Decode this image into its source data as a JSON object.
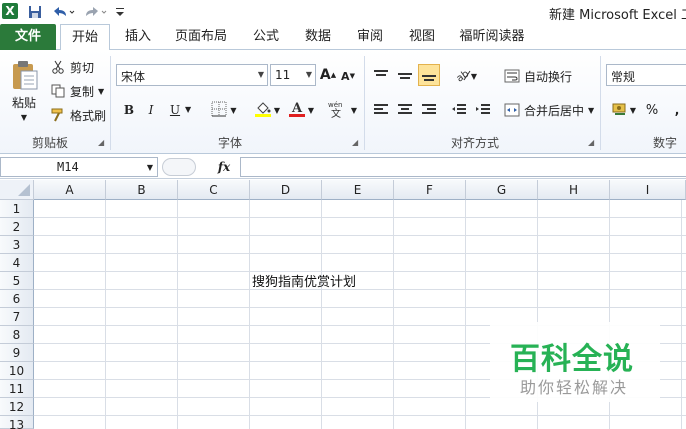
{
  "title": "新建 Microsoft Excel 工作表",
  "tabs": [
    {
      "label": "文件"
    },
    {
      "label": "开始"
    },
    {
      "label": "插入"
    },
    {
      "label": "页面布局"
    },
    {
      "label": "公式"
    },
    {
      "label": "数据"
    },
    {
      "label": "审阅"
    },
    {
      "label": "视图"
    },
    {
      "label": "福昕阅读器"
    }
  ],
  "ribbon": {
    "clipboard": {
      "group": "剪贴板",
      "paste": "粘贴",
      "cut": "剪切",
      "copy": "复制",
      "painter": "格式刷"
    },
    "font": {
      "group": "字体",
      "name": "宋体",
      "size": "11",
      "bold": "B",
      "italic": "I",
      "underline": "U"
    },
    "alignment": {
      "group": "对齐方式",
      "wrap": "自动换行",
      "merge": "合并后居中"
    },
    "number": {
      "group": "数字",
      "format": "常规",
      "percent": "%",
      "comma": ","
    }
  },
  "formula_bar": {
    "cell_ref": "M14",
    "fx": "fx",
    "value": ""
  },
  "grid": {
    "columns": [
      "A",
      "B",
      "C",
      "D",
      "E",
      "F",
      "G",
      "H",
      "I"
    ],
    "rows": [
      "1",
      "2",
      "3",
      "4",
      "5",
      "6",
      "7",
      "8",
      "9",
      "10",
      "11",
      "12",
      "13"
    ],
    "cell_D5": "搜狗指南优赏计划"
  },
  "watermark": {
    "title": "百科全说",
    "subtitle": "助你轻松解决"
  },
  "colors": {
    "file_tab": "#2b7a3a",
    "watermark_green": "#27b255",
    "highlight": "#fde39a"
  }
}
